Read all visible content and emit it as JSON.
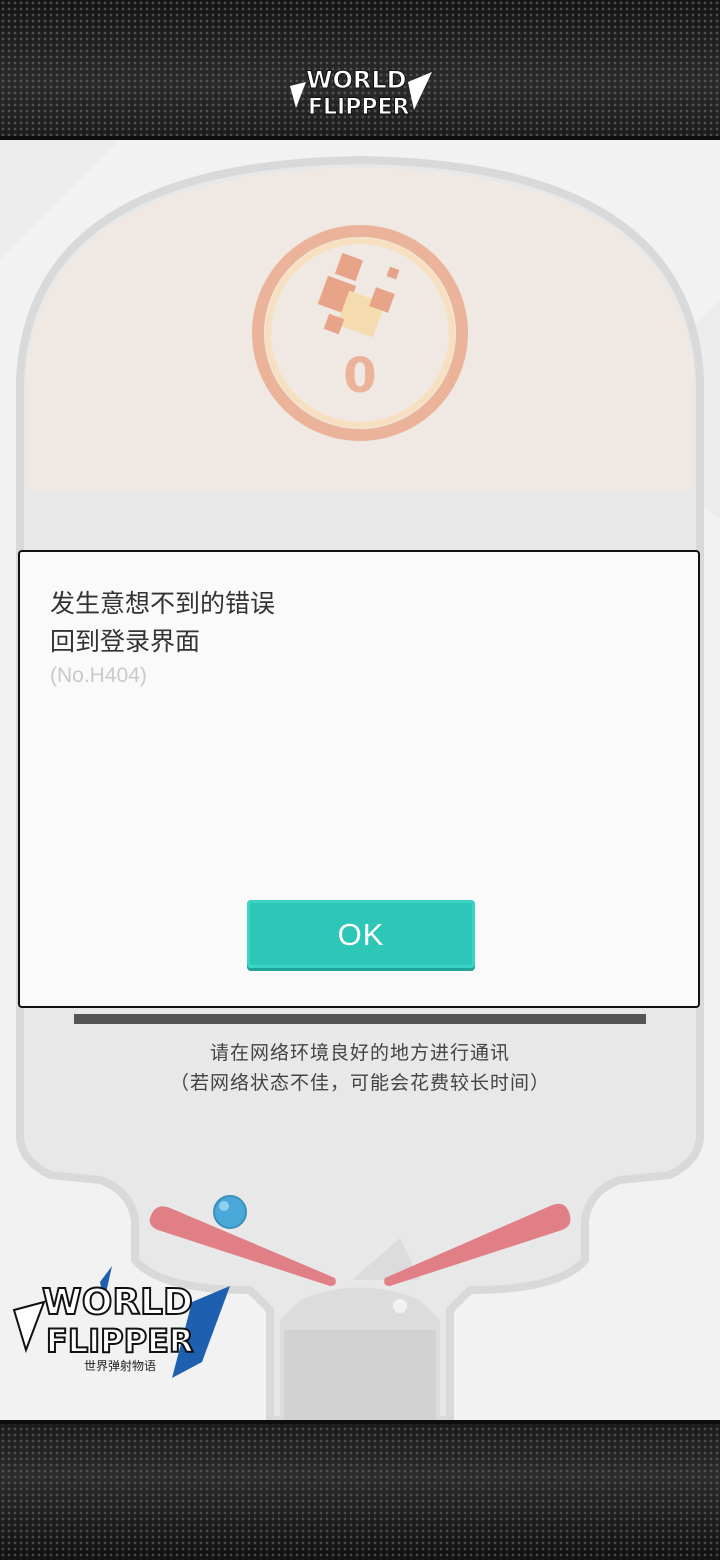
{
  "branding": {
    "logo_text_top": "WORLD",
    "logo_text_bottom": "FLIPPER",
    "subtitle": "世界弹射物语"
  },
  "board": {
    "score": "0"
  },
  "loading": {
    "message_line1": "请在网络环境良好的地方进行通讯",
    "message_line2": "（若网络状态不佳，可能会花费较长时间）"
  },
  "dialog": {
    "message_line1": "发生意想不到的错误",
    "message_line2": "回到登录界面",
    "error_code": "(No.H404)",
    "ok_label": "OK"
  },
  "colors": {
    "accent": "#2ec6b6",
    "flipper": "#e07f86",
    "ball": "#4aa8d8",
    "emblem_ring": "#e9a07a"
  },
  "icons": [
    "world-flipper-logo",
    "pinball-board",
    "cube-emblem-icon",
    "flipper-left",
    "flipper-right",
    "pinball-ball"
  ]
}
